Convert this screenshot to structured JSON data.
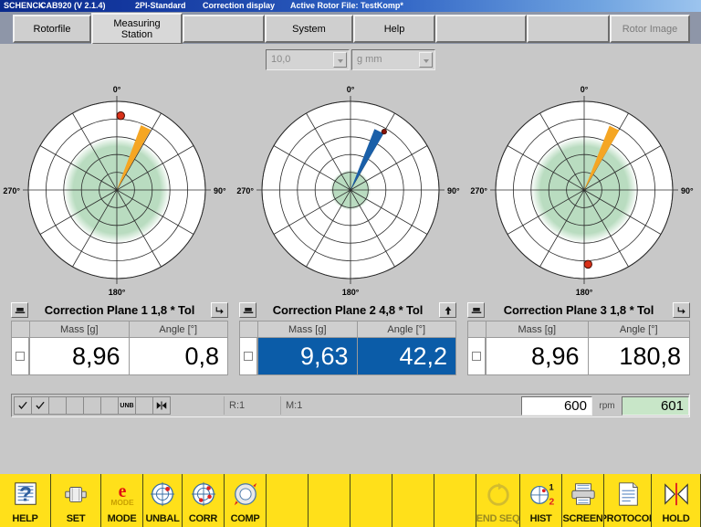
{
  "titlebar": {
    "brand": "SCHENCK",
    "app": "CAB920 (V 2.1.4)",
    "mode": "2Pl-Standard",
    "display": "Correction display",
    "rotor_file": "Active Rotor File: TestKomp*"
  },
  "menu": {
    "items": [
      {
        "label": "Rotorfile",
        "state": "normal"
      },
      {
        "label": "Measuring\nStation",
        "state": "active"
      },
      {
        "label": "",
        "state": "normal"
      },
      {
        "label": "System",
        "state": "normal"
      },
      {
        "label": "Help",
        "state": "normal"
      },
      {
        "label": "",
        "state": "normal"
      },
      {
        "label": "",
        "state": "normal"
      },
      {
        "label": "Rotor Image",
        "state": "disabled"
      }
    ]
  },
  "toolbar": {
    "tolerance_value": "10,0",
    "unit_value": "g mm"
  },
  "chart_data": [
    {
      "type": "polar",
      "title": "Correction Plane 1",
      "rings": 5,
      "angle_labels": [
        "0°",
        "90°",
        "180°",
        "270°"
      ],
      "tolerance_radius_pct": 60,
      "vector": {
        "angle_deg": 25,
        "magnitude_pct": 78,
        "color": "#f5a623"
      },
      "marker": {
        "angle_deg": 3,
        "radius_pct": 84,
        "color": "#d83018"
      }
    },
    {
      "type": "polar",
      "title": "Correction Plane 2",
      "rings": 5,
      "angle_labels": [
        "0°",
        "90°",
        "180°",
        "270°"
      ],
      "tolerance_radius_pct": 23,
      "vector": {
        "angle_deg": 26,
        "magnitude_pct": 74,
        "color": "#1a5fa8"
      },
      "marker": {
        "angle_deg": 30,
        "radius_pct": 76,
        "color": "#8a1208"
      }
    },
    {
      "type": "polar",
      "title": "Correction Plane 3",
      "rings": 5,
      "angle_labels": [
        "0°",
        "90°",
        "180°",
        "270°"
      ],
      "tolerance_radius_pct": 60,
      "vector": {
        "angle_deg": 26,
        "magnitude_pct": 78,
        "color": "#f5a623"
      },
      "marker": {
        "angle_deg": 177,
        "radius_pct": 84,
        "color": "#d83018"
      }
    }
  ],
  "planes": [
    {
      "title": "Correction Plane 1   1,8 * Tol",
      "left_icon": "plane-view-icon",
      "right_icon": "corner-arrow-icon",
      "columns": [
        "Mass [g]",
        "Angle [°]"
      ],
      "mass": "8,96",
      "angle": "0,8",
      "selected": false
    },
    {
      "title": "Correction Plane 2   4,8 * Tol",
      "left_icon": "plane-view-icon",
      "right_icon": "up-arrow-icon",
      "columns": [
        "Mass [g]",
        "Angle [°]"
      ],
      "mass": "9,63",
      "angle": "42,2",
      "selected": true
    },
    {
      "title": "Correction Plane 3   1,8 * Tol",
      "left_icon": "plane-view-icon",
      "right_icon": "corner-arrow-icon",
      "columns": [
        "Mass [g]",
        "Angle [°]"
      ],
      "mass": "8,96",
      "angle": "180,8",
      "selected": false
    }
  ],
  "statusbar": {
    "cells": [
      {
        "icon": "check-icon",
        "label": ""
      },
      {
        "icon": "check-icon",
        "label": ""
      },
      {
        "icon": "",
        "label": ""
      },
      {
        "icon": "",
        "label": ""
      },
      {
        "icon": "",
        "label": ""
      },
      {
        "icon": "",
        "label": ""
      },
      {
        "icon": "",
        "label": "UNB"
      },
      {
        "icon": "",
        "label": ""
      },
      {
        "icon": "bowtie-icon",
        "label": ""
      }
    ],
    "run_label": "R:1",
    "measure_label": "M:1",
    "rpm_setpoint": "600",
    "rpm_unit": "rpm",
    "rpm_actual": "601"
  },
  "fkeys": [
    {
      "label": "HELP",
      "icon": "help-document-icon",
      "state": "normal"
    },
    {
      "label": "SET",
      "icon": "rotor-icon",
      "state": "normal"
    },
    {
      "label": "MODE",
      "icon": "e-mode-icon",
      "state": "normal"
    },
    {
      "label": "UNBAL",
      "icon": "target-icon",
      "state": "normal"
    },
    {
      "label": "CORR",
      "icon": "target-dots-icon",
      "state": "normal"
    },
    {
      "label": "COMP",
      "icon": "comp-disc-icon",
      "state": "normal"
    },
    {
      "label": "",
      "icon": "",
      "state": "empty"
    },
    {
      "label": "",
      "icon": "",
      "state": "empty"
    },
    {
      "label": "",
      "icon": "",
      "state": "empty"
    },
    {
      "label": "",
      "icon": "",
      "state": "empty"
    },
    {
      "label": "",
      "icon": "",
      "state": "empty"
    },
    {
      "label": "END SEQ",
      "icon": "end-sequence-icon",
      "state": "disabled"
    },
    {
      "label": "HIST",
      "icon": "history-icon",
      "state": "normal"
    },
    {
      "label": "SCREEN",
      "icon": "printer-icon",
      "state": "normal"
    },
    {
      "label": "PROTOCOL",
      "icon": "document-icon",
      "state": "normal"
    },
    {
      "label": "HOLD",
      "icon": "hold-icon",
      "state": "normal"
    }
  ],
  "colors": {
    "tolerance_green": "#b9dcc0",
    "vector_orange": "#f5a623",
    "vector_blue": "#1a5fa8",
    "marker_red": "#d83018",
    "selection_blue": "#0b5ca8",
    "fkey_yellow": "#ffe01a",
    "rpm_green": "#c8e6c8"
  }
}
